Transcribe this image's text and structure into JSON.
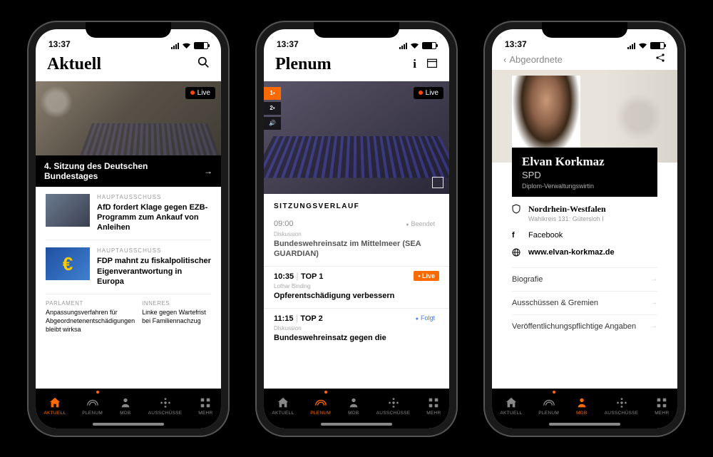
{
  "status": {
    "time": "13:37"
  },
  "tabs": {
    "aktuell": "AKTUELL",
    "plenum": "PLENUM",
    "mdb": "MDB",
    "ausschuesse": "AUSSCHÜSSE",
    "mehr": "MEHR"
  },
  "phone1": {
    "title": "Aktuell",
    "live_label": "Live",
    "feature_caption": "4. Sitzung des Deutschen Bundestages",
    "news": [
      {
        "category": "HAUPTAUSSCHUSS",
        "title": "AfD fordert Klage gegen EZB-Programm zum Ankauf von Anleihen"
      },
      {
        "category": "HAUPTAUSSCHUSS",
        "title": "FDP mahnt zu fiskalpolitischer Eigenverantwortung in Europa"
      }
    ],
    "mini": [
      {
        "category": "PARLAMENT",
        "title": "Anpassungsverfahren für Abgeordnetenentschädigungen bleibt wirksa"
      },
      {
        "category": "INNERES",
        "title": "Linke gegen Wartefrist bei Familiennachzug"
      }
    ]
  },
  "phone2": {
    "title": "Plenum",
    "live_label": "Live",
    "section": "SITZUNGSVERLAUF",
    "items": [
      {
        "time": "09:00",
        "top": "",
        "status_label": "Beendet",
        "category": "Diskussion",
        "title": "Bundeswehreinsatz im Mittelmeer (SEA GUARDIAN)"
      },
      {
        "time": "10:35",
        "top": "TOP 1",
        "status_label": "Live",
        "category": "Lothar Binding",
        "title": "Opferentschädigung verbessern"
      },
      {
        "time": "11:15",
        "top": "TOP 2",
        "status_label": "Folgt",
        "category": "Diskussion",
        "title": "Bundeswehreinsatz gegen die"
      }
    ]
  },
  "phone3": {
    "back": "Abgeordnete",
    "name": "Elvan Korkmaz",
    "party": "SPD",
    "profession": "Diplom-Verwaltungswirtin",
    "region": "Nordrhein-Westfalen",
    "district": "Wahlkreis 131: Gütersloh I",
    "social": "Facebook",
    "website": "www.elvan-korkmaz.de",
    "links": [
      "Biografie",
      "Ausschüssen & Gremien",
      "Veröffentlichungspflichtige Angaben"
    ]
  }
}
